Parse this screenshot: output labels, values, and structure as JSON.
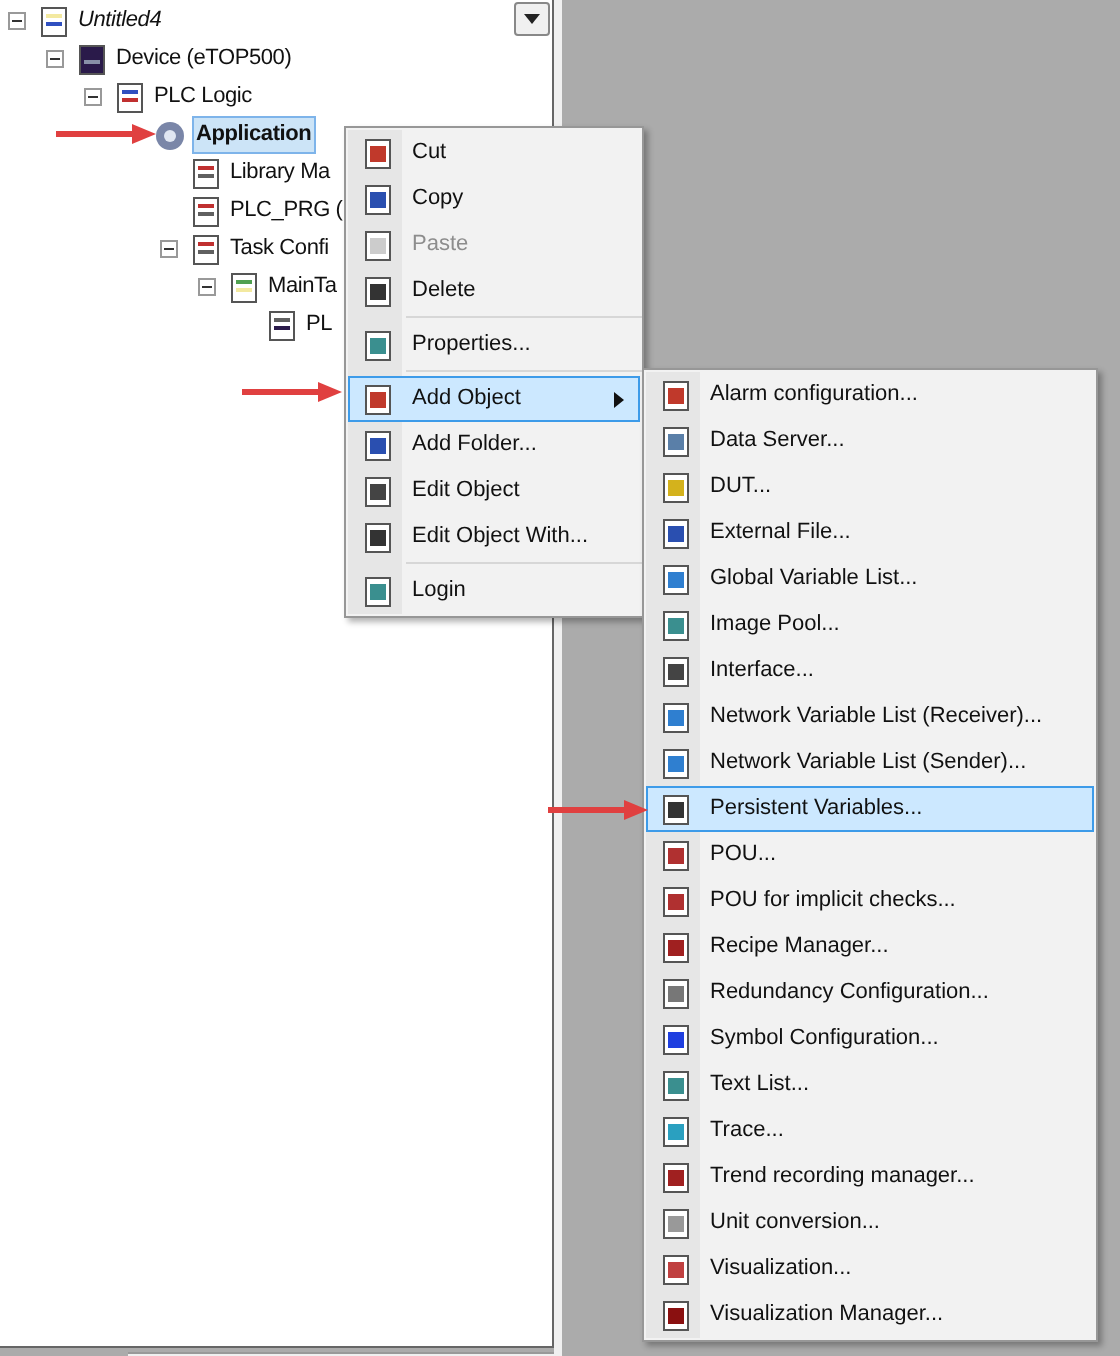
{
  "tree": [
    {
      "label": "Untitled4",
      "expanded": true,
      "selected": false,
      "children": [
        {
          "label": "Device (eTOP500)",
          "expanded": true,
          "selected": false,
          "children": [
            {
              "label": "PLC Logic",
              "expanded": true,
              "selected": false,
              "children": [
                {
                  "label": "Application",
                  "selected": true,
                  "children": [
                    {
                      "label": "Library Ma",
                      "selected": false
                    },
                    {
                      "label": "PLC_PRG (",
                      "selected": false
                    },
                    {
                      "label": "Task Confi",
                      "expanded": true,
                      "selected": false,
                      "children": [
                        {
                          "label": "MainTa",
                          "expanded": true,
                          "selected": false,
                          "children": [
                            {
                              "label": "PL",
                              "selected": false
                            }
                          ]
                        }
                      ]
                    }
                  ]
                }
              ]
            }
          ]
        }
      ]
    }
  ],
  "context_menu": [
    {
      "kind": "item",
      "label": "Cut",
      "disabled": false,
      "selected": false
    },
    {
      "kind": "item",
      "label": "Copy",
      "disabled": false,
      "selected": false
    },
    {
      "kind": "item",
      "label": "Paste",
      "disabled": true,
      "selected": false
    },
    {
      "kind": "item",
      "label": "Delete",
      "disabled": false,
      "selected": false
    },
    {
      "kind": "separator"
    },
    {
      "kind": "item",
      "label": "Properties...",
      "disabled": false,
      "selected": false
    },
    {
      "kind": "separator"
    },
    {
      "kind": "submenu",
      "label": "Add Object",
      "disabled": false,
      "selected": true
    },
    {
      "kind": "item",
      "label": "Add Folder...",
      "disabled": false,
      "selected": false
    },
    {
      "kind": "item",
      "label": "Edit Object",
      "disabled": false,
      "selected": false
    },
    {
      "kind": "item",
      "label": "Edit Object With...",
      "disabled": false,
      "selected": false
    },
    {
      "kind": "separator"
    },
    {
      "kind": "item",
      "label": "Login",
      "disabled": false,
      "selected": false
    }
  ],
  "submenu": [
    {
      "label": "Alarm configuration...",
      "selected": false
    },
    {
      "label": "Data Server...",
      "selected": false
    },
    {
      "label": "DUT...",
      "selected": false
    },
    {
      "label": "External File...",
      "selected": false
    },
    {
      "label": "Global Variable List...",
      "selected": false
    },
    {
      "label": "Image Pool...",
      "selected": false
    },
    {
      "label": "Interface...",
      "selected": false
    },
    {
      "label": "Network Variable List (Receiver)...",
      "selected": false
    },
    {
      "label": "Network Variable List (Sender)...",
      "selected": false
    },
    {
      "label": "Persistent Variables...",
      "selected": true
    },
    {
      "label": "POU...",
      "selected": false
    },
    {
      "label": "POU for implicit checks...",
      "selected": false
    },
    {
      "label": "Recipe Manager...",
      "selected": false
    },
    {
      "label": "Redundancy Configuration...",
      "selected": false
    },
    {
      "label": "Symbol Configuration...",
      "selected": false
    },
    {
      "label": "Text List...",
      "selected": false
    },
    {
      "label": "Trace...",
      "selected": false
    },
    {
      "label": "Trend recording manager...",
      "selected": false
    },
    {
      "label": "Unit conversion...",
      "selected": false
    },
    {
      "label": "Visualization...",
      "selected": false
    },
    {
      "label": "Visualization Manager...",
      "selected": false
    }
  ]
}
